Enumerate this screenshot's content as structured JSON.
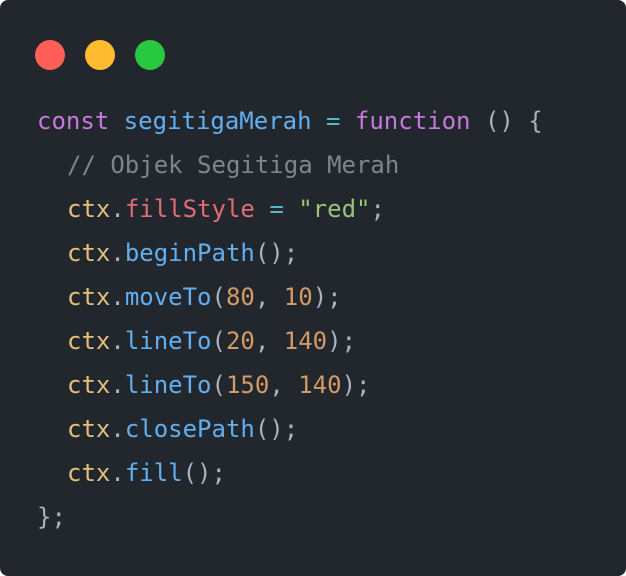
{
  "window": {
    "controls": [
      {
        "name": "close",
        "color": "#ff5f57"
      },
      {
        "name": "minimize",
        "color": "#febc2e"
      },
      {
        "name": "maximize",
        "color": "#28c840"
      }
    ]
  },
  "code": {
    "lines": [
      {
        "indent": 0,
        "tokens": [
          {
            "t": "const",
            "c": "kw"
          },
          {
            "t": " ",
            "c": "pn"
          },
          {
            "t": "segitigaMerah",
            "c": "fn"
          },
          {
            "t": " ",
            "c": "pn"
          },
          {
            "t": "=",
            "c": "op"
          },
          {
            "t": " ",
            "c": "pn"
          },
          {
            "t": "function",
            "c": "kw"
          },
          {
            "t": " () {",
            "c": "pn"
          }
        ]
      },
      {
        "indent": 1,
        "tokens": [
          {
            "t": "// Objek Segitiga Merah",
            "c": "cm"
          }
        ]
      },
      {
        "indent": 1,
        "tokens": [
          {
            "t": "ctx",
            "c": "obj"
          },
          {
            "t": ".",
            "c": "pn"
          },
          {
            "t": "fillStyle",
            "c": "prop"
          },
          {
            "t": " ",
            "c": "pn"
          },
          {
            "t": "=",
            "c": "op"
          },
          {
            "t": " ",
            "c": "pn"
          },
          {
            "t": "\"red\"",
            "c": "str"
          },
          {
            "t": ";",
            "c": "pn"
          }
        ]
      },
      {
        "indent": 1,
        "tokens": [
          {
            "t": "ctx",
            "c": "obj"
          },
          {
            "t": ".",
            "c": "pn"
          },
          {
            "t": "beginPath",
            "c": "fn"
          },
          {
            "t": "();",
            "c": "pn"
          }
        ]
      },
      {
        "indent": 1,
        "tokens": [
          {
            "t": "ctx",
            "c": "obj"
          },
          {
            "t": ".",
            "c": "pn"
          },
          {
            "t": "moveTo",
            "c": "fn"
          },
          {
            "t": "(",
            "c": "pn"
          },
          {
            "t": "80",
            "c": "num"
          },
          {
            "t": ", ",
            "c": "pn"
          },
          {
            "t": "10",
            "c": "num"
          },
          {
            "t": ");",
            "c": "pn"
          }
        ]
      },
      {
        "indent": 1,
        "tokens": [
          {
            "t": "ctx",
            "c": "obj"
          },
          {
            "t": ".",
            "c": "pn"
          },
          {
            "t": "lineTo",
            "c": "fn"
          },
          {
            "t": "(",
            "c": "pn"
          },
          {
            "t": "20",
            "c": "num"
          },
          {
            "t": ", ",
            "c": "pn"
          },
          {
            "t": "140",
            "c": "num"
          },
          {
            "t": ");",
            "c": "pn"
          }
        ]
      },
      {
        "indent": 1,
        "tokens": [
          {
            "t": "ctx",
            "c": "obj"
          },
          {
            "t": ".",
            "c": "pn"
          },
          {
            "t": "lineTo",
            "c": "fn"
          },
          {
            "t": "(",
            "c": "pn"
          },
          {
            "t": "150",
            "c": "num"
          },
          {
            "t": ", ",
            "c": "pn"
          },
          {
            "t": "140",
            "c": "num"
          },
          {
            "t": ");",
            "c": "pn"
          }
        ]
      },
      {
        "indent": 1,
        "tokens": [
          {
            "t": "ctx",
            "c": "obj"
          },
          {
            "t": ".",
            "c": "pn"
          },
          {
            "t": "closePath",
            "c": "fn"
          },
          {
            "t": "();",
            "c": "pn"
          }
        ]
      },
      {
        "indent": 1,
        "tokens": [
          {
            "t": "ctx",
            "c": "obj"
          },
          {
            "t": ".",
            "c": "pn"
          },
          {
            "t": "fill",
            "c": "fn"
          },
          {
            "t": "();",
            "c": "pn"
          }
        ]
      },
      {
        "indent": 0,
        "tokens": [
          {
            "t": "};",
            "c": "pn"
          }
        ]
      }
    ]
  }
}
